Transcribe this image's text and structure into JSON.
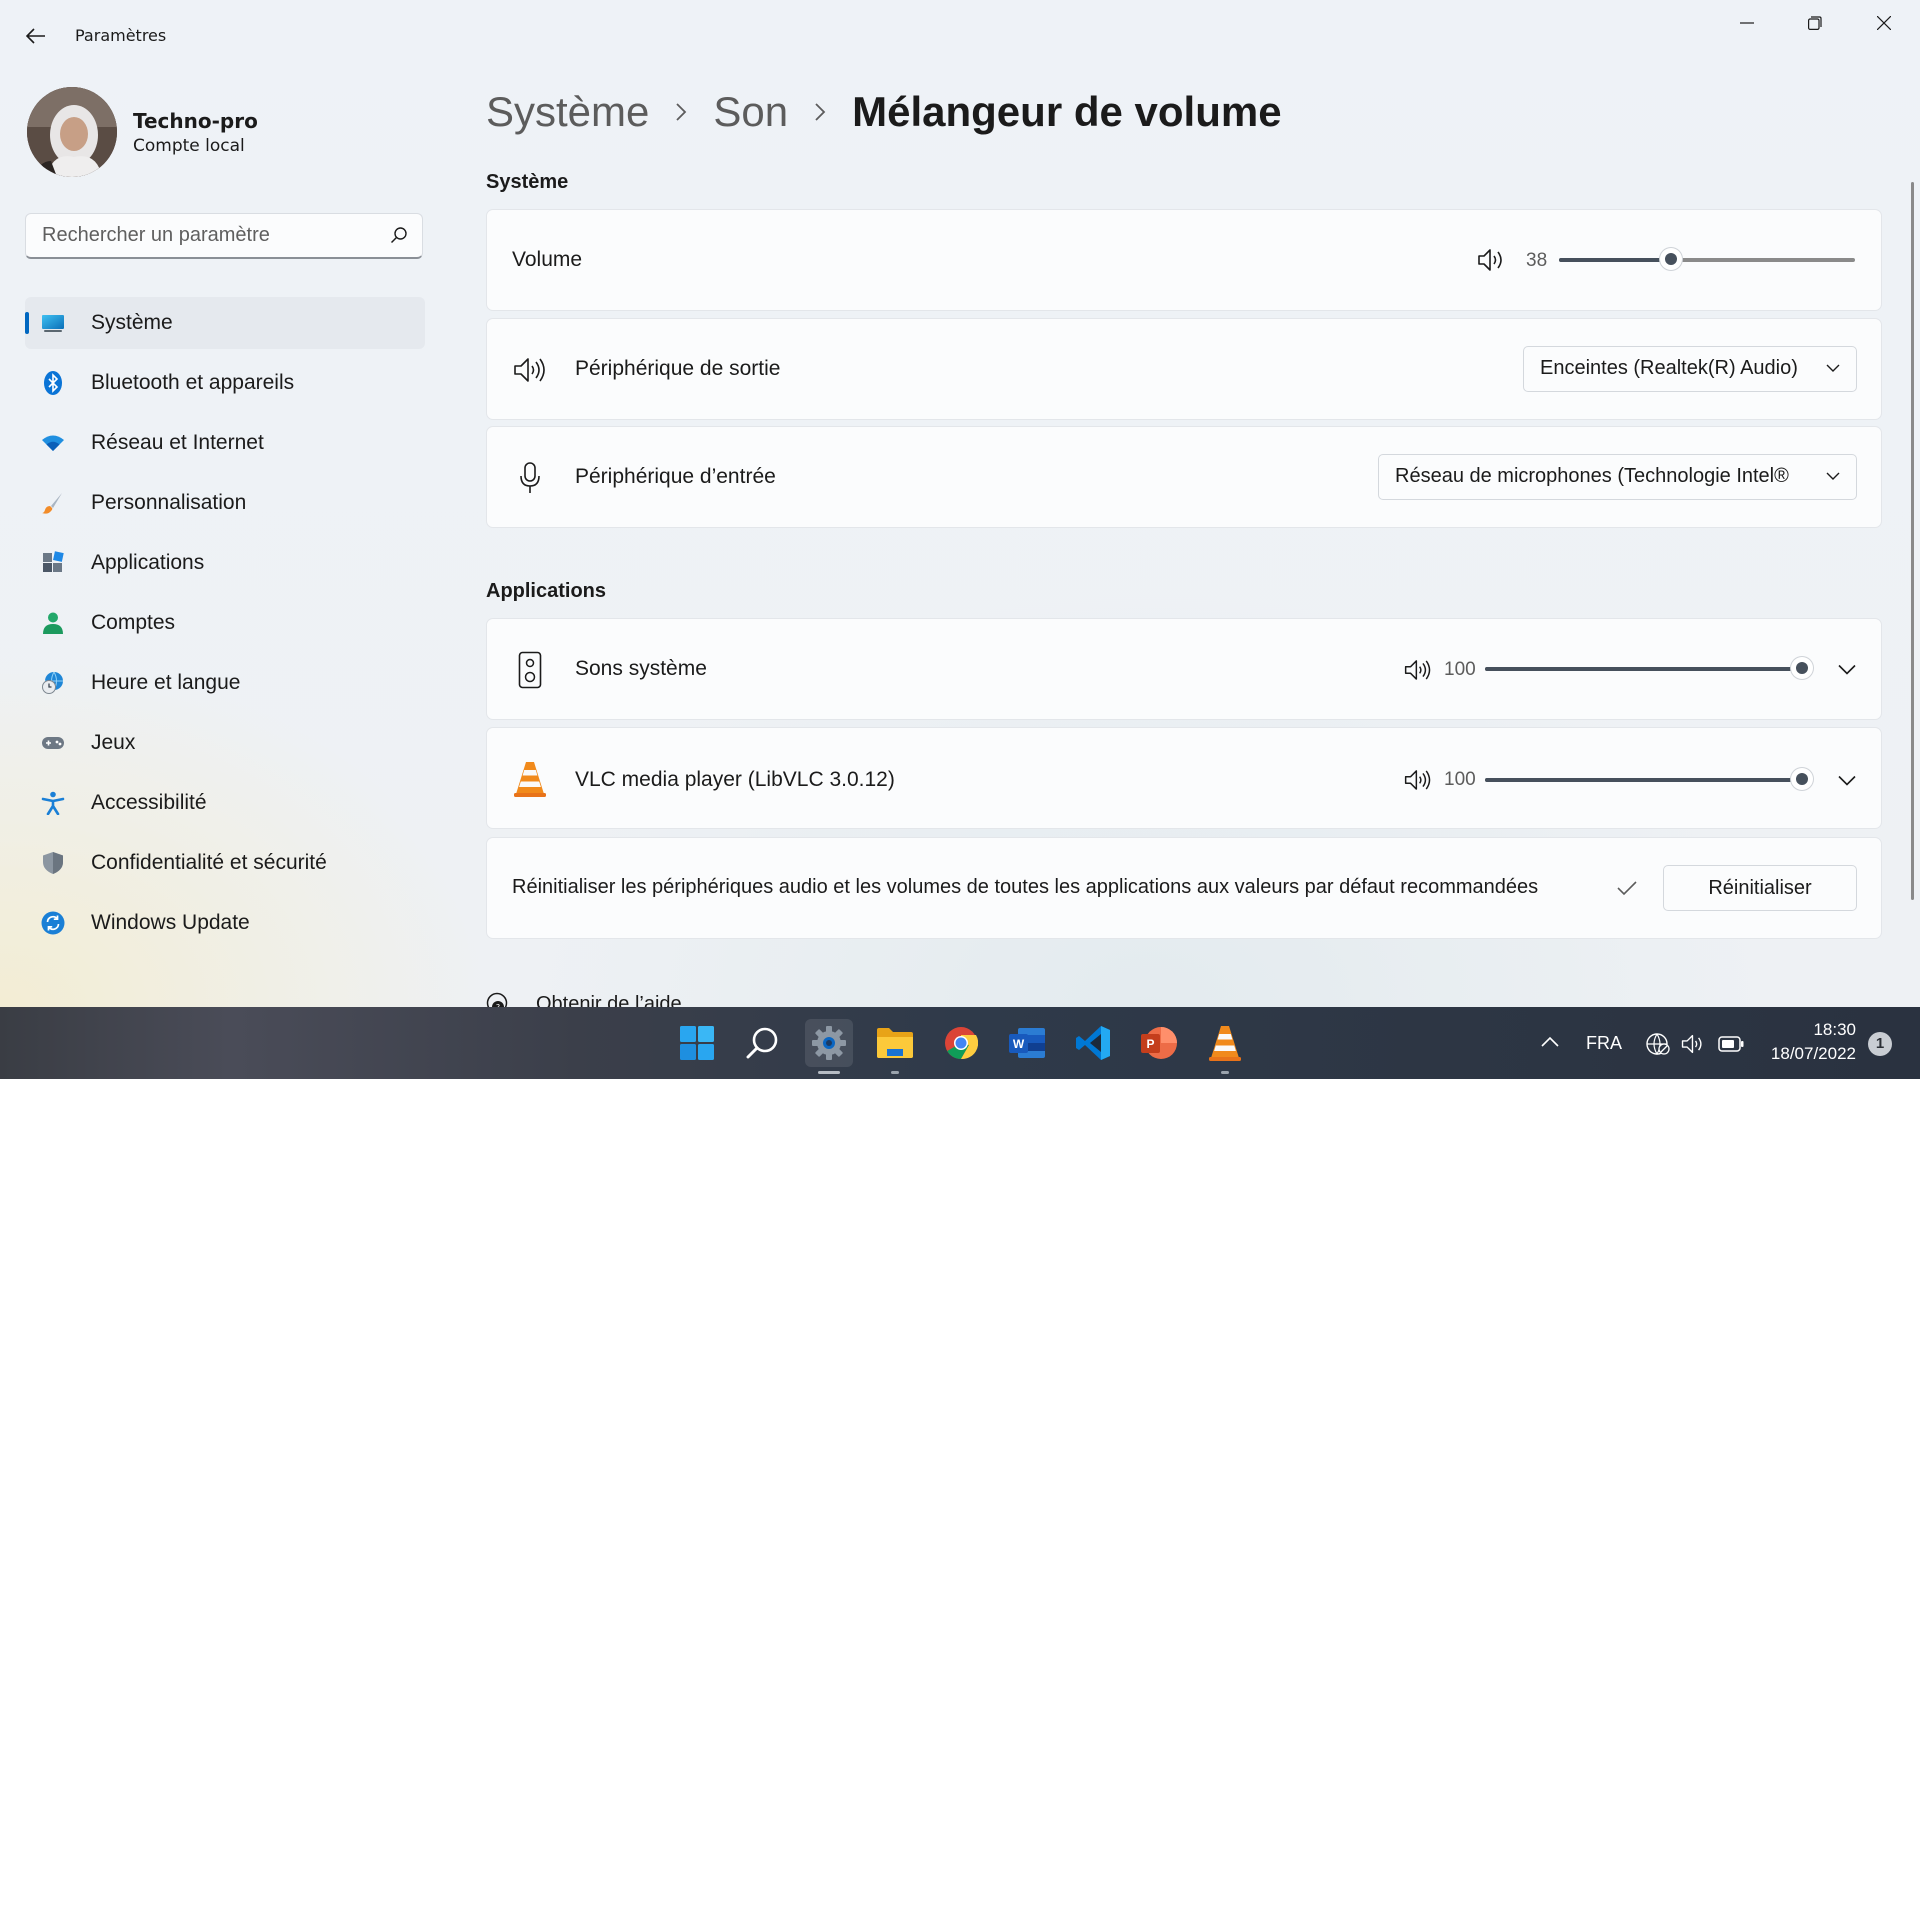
{
  "window": {
    "title": "Paramètres"
  },
  "profile": {
    "name": "Techno-pro",
    "account_type": "Compte local"
  },
  "search": {
    "placeholder": "Rechercher un paramètre"
  },
  "nav": {
    "items": [
      {
        "label": "Système",
        "icon": "monitor-icon",
        "active": true
      },
      {
        "label": "Bluetooth et appareils",
        "icon": "bluetooth-icon"
      },
      {
        "label": "Réseau et Internet",
        "icon": "wifi-icon"
      },
      {
        "label": "Personnalisation",
        "icon": "brush-icon"
      },
      {
        "label": "Applications",
        "icon": "apps-icon"
      },
      {
        "label": "Comptes",
        "icon": "person-icon"
      },
      {
        "label": "Heure et langue",
        "icon": "globe-clock-icon"
      },
      {
        "label": "Jeux",
        "icon": "gamepad-icon"
      },
      {
        "label": "Accessibilité",
        "icon": "accessibility-icon"
      },
      {
        "label": "Confidentialité et sécurité",
        "icon": "shield-icon"
      },
      {
        "label": "Windows Update",
        "icon": "sync-icon"
      }
    ]
  },
  "breadcrumb": {
    "level1": "Système",
    "level2": "Son",
    "current": "Mélangeur de volume"
  },
  "system_section": {
    "title": "Système",
    "volume": {
      "label": "Volume",
      "value": "38",
      "level": 0.38
    },
    "output": {
      "label": "Périphérique de sortie",
      "selected": "Enceintes (Realtek(R) Audio)"
    },
    "input": {
      "label": "Périphérique d’entrée",
      "selected": "Réseau de microphones (Technologie Intel®"
    }
  },
  "apps_section": {
    "title": "Applications",
    "apps": [
      {
        "name": "Sons système",
        "value": "100",
        "level": 1.0,
        "icon": "speaker-device-icon"
      },
      {
        "name": "VLC media player (LibVLC 3.0.12)",
        "value": "100",
        "level": 1.0,
        "icon": "vlc-cone-icon"
      }
    ]
  },
  "reset": {
    "text": "Réinitialiser les périphériques audio et les volumes de toutes les applications aux valeurs par défaut recommandées",
    "button": "Réinitialiser"
  },
  "help": {
    "label": "Obtenir de l’aide"
  },
  "taskbar": {
    "apps": [
      "windows-start-icon",
      "search-icon",
      "settings-icon",
      "file-explorer-icon",
      "chrome-icon",
      "word-icon",
      "vscode-icon",
      "powerpoint-icon",
      "vlc-icon"
    ],
    "language": "FRA",
    "time": "18:30",
    "date": "18/07/2022",
    "notification_count": "1"
  },
  "colors": {
    "accent": "#0067c0",
    "slider": "#46505c",
    "taskbar": "#2f3a4a"
  }
}
